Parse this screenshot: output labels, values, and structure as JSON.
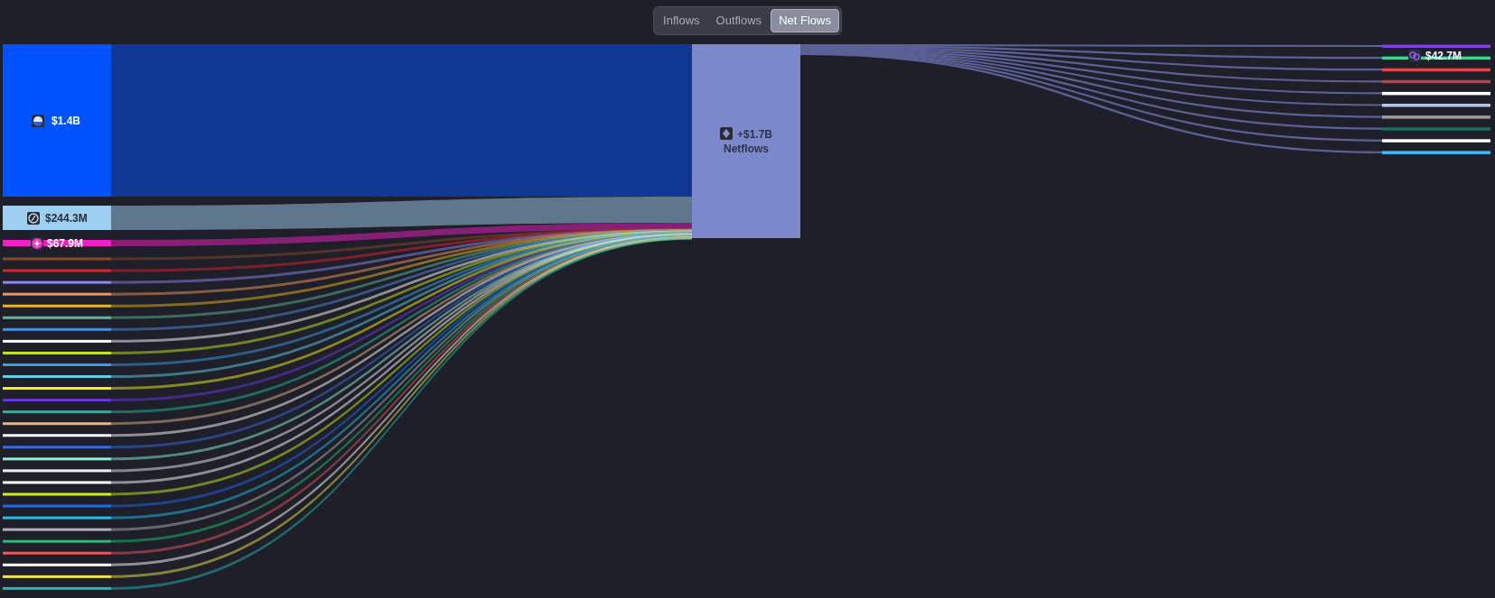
{
  "tabs": [
    {
      "label": "Inflows",
      "selected": false
    },
    {
      "label": "Outflows",
      "selected": false
    },
    {
      "label": "Net Flows",
      "selected": true
    }
  ],
  "left_nodes": [
    {
      "color": "#0052ff",
      "label": "$1.4B"
    },
    {
      "color": "#9ecff0",
      "label": "$244.3M"
    },
    {
      "color": "#f21fc4",
      "label": "$67.9M"
    },
    {
      "color": "#8a4a2a"
    },
    {
      "color": "#e0242c"
    },
    {
      "color": "#8a87f0"
    },
    {
      "color": "#f0965a"
    },
    {
      "color": "#e8b820"
    },
    {
      "color": "#5cb896"
    },
    {
      "color": "#4a90e2"
    },
    {
      "color": "#ffffff"
    },
    {
      "color": "#c8e61e"
    },
    {
      "color": "#3aa0e8"
    },
    {
      "color": "#5ccfe8"
    },
    {
      "color": "#f5f020"
    },
    {
      "color": "#6a38e0"
    },
    {
      "color": "#22b8a0"
    },
    {
      "color": "#e0b48a"
    },
    {
      "color": "#ffffff"
    },
    {
      "color": "#3a6ae0"
    },
    {
      "color": "#8af0d8"
    },
    {
      "color": "#eeeeee"
    },
    {
      "color": "#ffffff"
    },
    {
      "color": "#c8f01e"
    },
    {
      "color": "#1e6af0"
    },
    {
      "color": "#1ec0f0"
    },
    {
      "color": "#b0b0b8"
    },
    {
      "color": "#1ec070"
    },
    {
      "color": "#e85a5a"
    },
    {
      "color": "#ffffff"
    },
    {
      "color": "#f0e64a"
    },
    {
      "color": "#20b8b8"
    }
  ],
  "center_node": {
    "color": "#7b89cc",
    "value": "+$1.7B",
    "label": "Netflows"
  },
  "right_nodes": [
    {
      "color": "#7b3fe4"
    },
    {
      "color": "#1ee58c",
      "label": "$42.7M"
    },
    {
      "color": "#e04848"
    },
    {
      "color": "#c04040"
    },
    {
      "color": "#ffffff"
    },
    {
      "color": "#b0c8f0"
    },
    {
      "color": "#9a9a9a"
    },
    {
      "color": "#16735a"
    },
    {
      "color": "#ffffff"
    },
    {
      "color": "#38bdf8"
    }
  ]
}
